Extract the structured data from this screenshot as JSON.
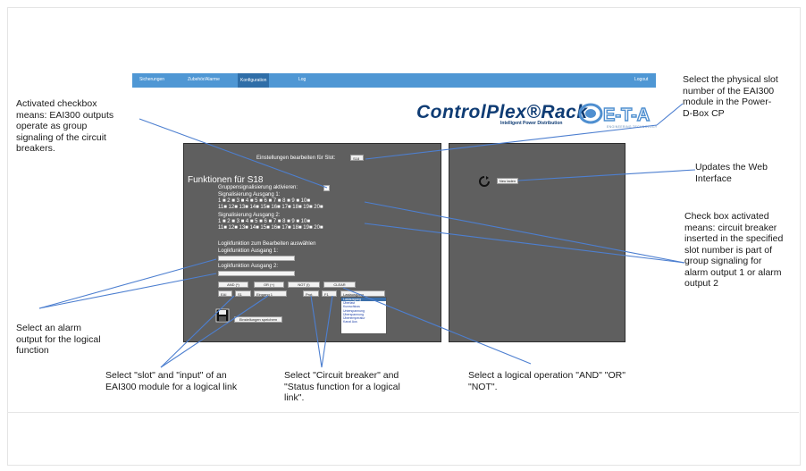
{
  "nav": {
    "items": [
      "Sicherungen",
      "Zubehör/Alarme",
      "Konfiguration",
      "Log"
    ],
    "logout": "Logout"
  },
  "brand": {
    "name": "ControlPlex®Rack",
    "tagline": "Intelligent Power Distribution",
    "logo": "E-T-A",
    "logo_sub": "ENGINEERING TECHNOLOGY"
  },
  "panel": {
    "slot_label": "Einstellungen bearbeiten für Slot:",
    "slot_value": "S18",
    "functions_title": "Funktionen für S18",
    "group_label": "Gruppensignalisierung aktivieren:",
    "out1_label": "Signalisierung Ausgang 1:",
    "row1": "1 ■ 2 ■ 3 ■ 4 ■ 5 ■ 6 ■ 7 ■ 8 ■ 9 ■ 10■",
    "row2": "11■ 12■ 13■ 14■ 15■ 16■ 17■ 18■ 19■ 20■",
    "out2_label": "Signalisierung Ausgang 2:",
    "logic_select_label": "Logikfunktion zum Bearbeiten auswählen",
    "logic_out1": "Logikfunktion Ausgang 1:",
    "logic_out2": "Logikfunktion Ausgang 2:",
    "btn_and": "AND (*)",
    "btn_or": "OR (+)",
    "btn_not": "NOT (!)",
    "btn_clear": "CLEAR",
    "sel_ein": "EAI",
    "sel_slot": "S1",
    "sel_input": "Eingang 1",
    "sel_prot": "Prot.",
    "sel_f": "F1",
    "sel_status": "Lastausgang",
    "dropdown_options": [
      "Lastausgang",
      "Überlast",
      "Kurzschluss",
      "Unterspannung",
      "Überspannung",
      "Übertemperatur",
      "Kanal Aus"
    ],
    "save_label": "Einstellungen speichern",
    "update_label": "Neu laden"
  },
  "annotations": {
    "slot": "Select the physical slot\nnumber of the EAI300\nmodule in the Power-\nD-Box CP",
    "checkbox": "Activated checkbox\nmeans: EAI300 outputs\noperate as group\nsignaling of the circuit\nbreakers.",
    "update": "Updates the Web\nInterface",
    "checkbox_activated": "Check box activated\nmeans: circuit breaker\ninserted in the specified\nslot number is part of\ngroup signaling for\nalarm output 1 or alarm\noutput 2",
    "alarm_output": "Select an alarm\noutput for the logical\nfunction",
    "slot_input": "Select \"slot\" and \"input\" of an\nEAI300 module for a logical link",
    "breaker_status": "Select \"Circuit breaker\" and\n\"Status function for a logical\nlink\".",
    "logical_op": "Select a logical operation \"AND\" \"OR\"\n\"NOT\"."
  },
  "colors": {
    "navbar": "#4f97d4",
    "panel": "#5f5f5f",
    "brand": "#0f3c74",
    "annotation_line": "#4d7fd0"
  }
}
